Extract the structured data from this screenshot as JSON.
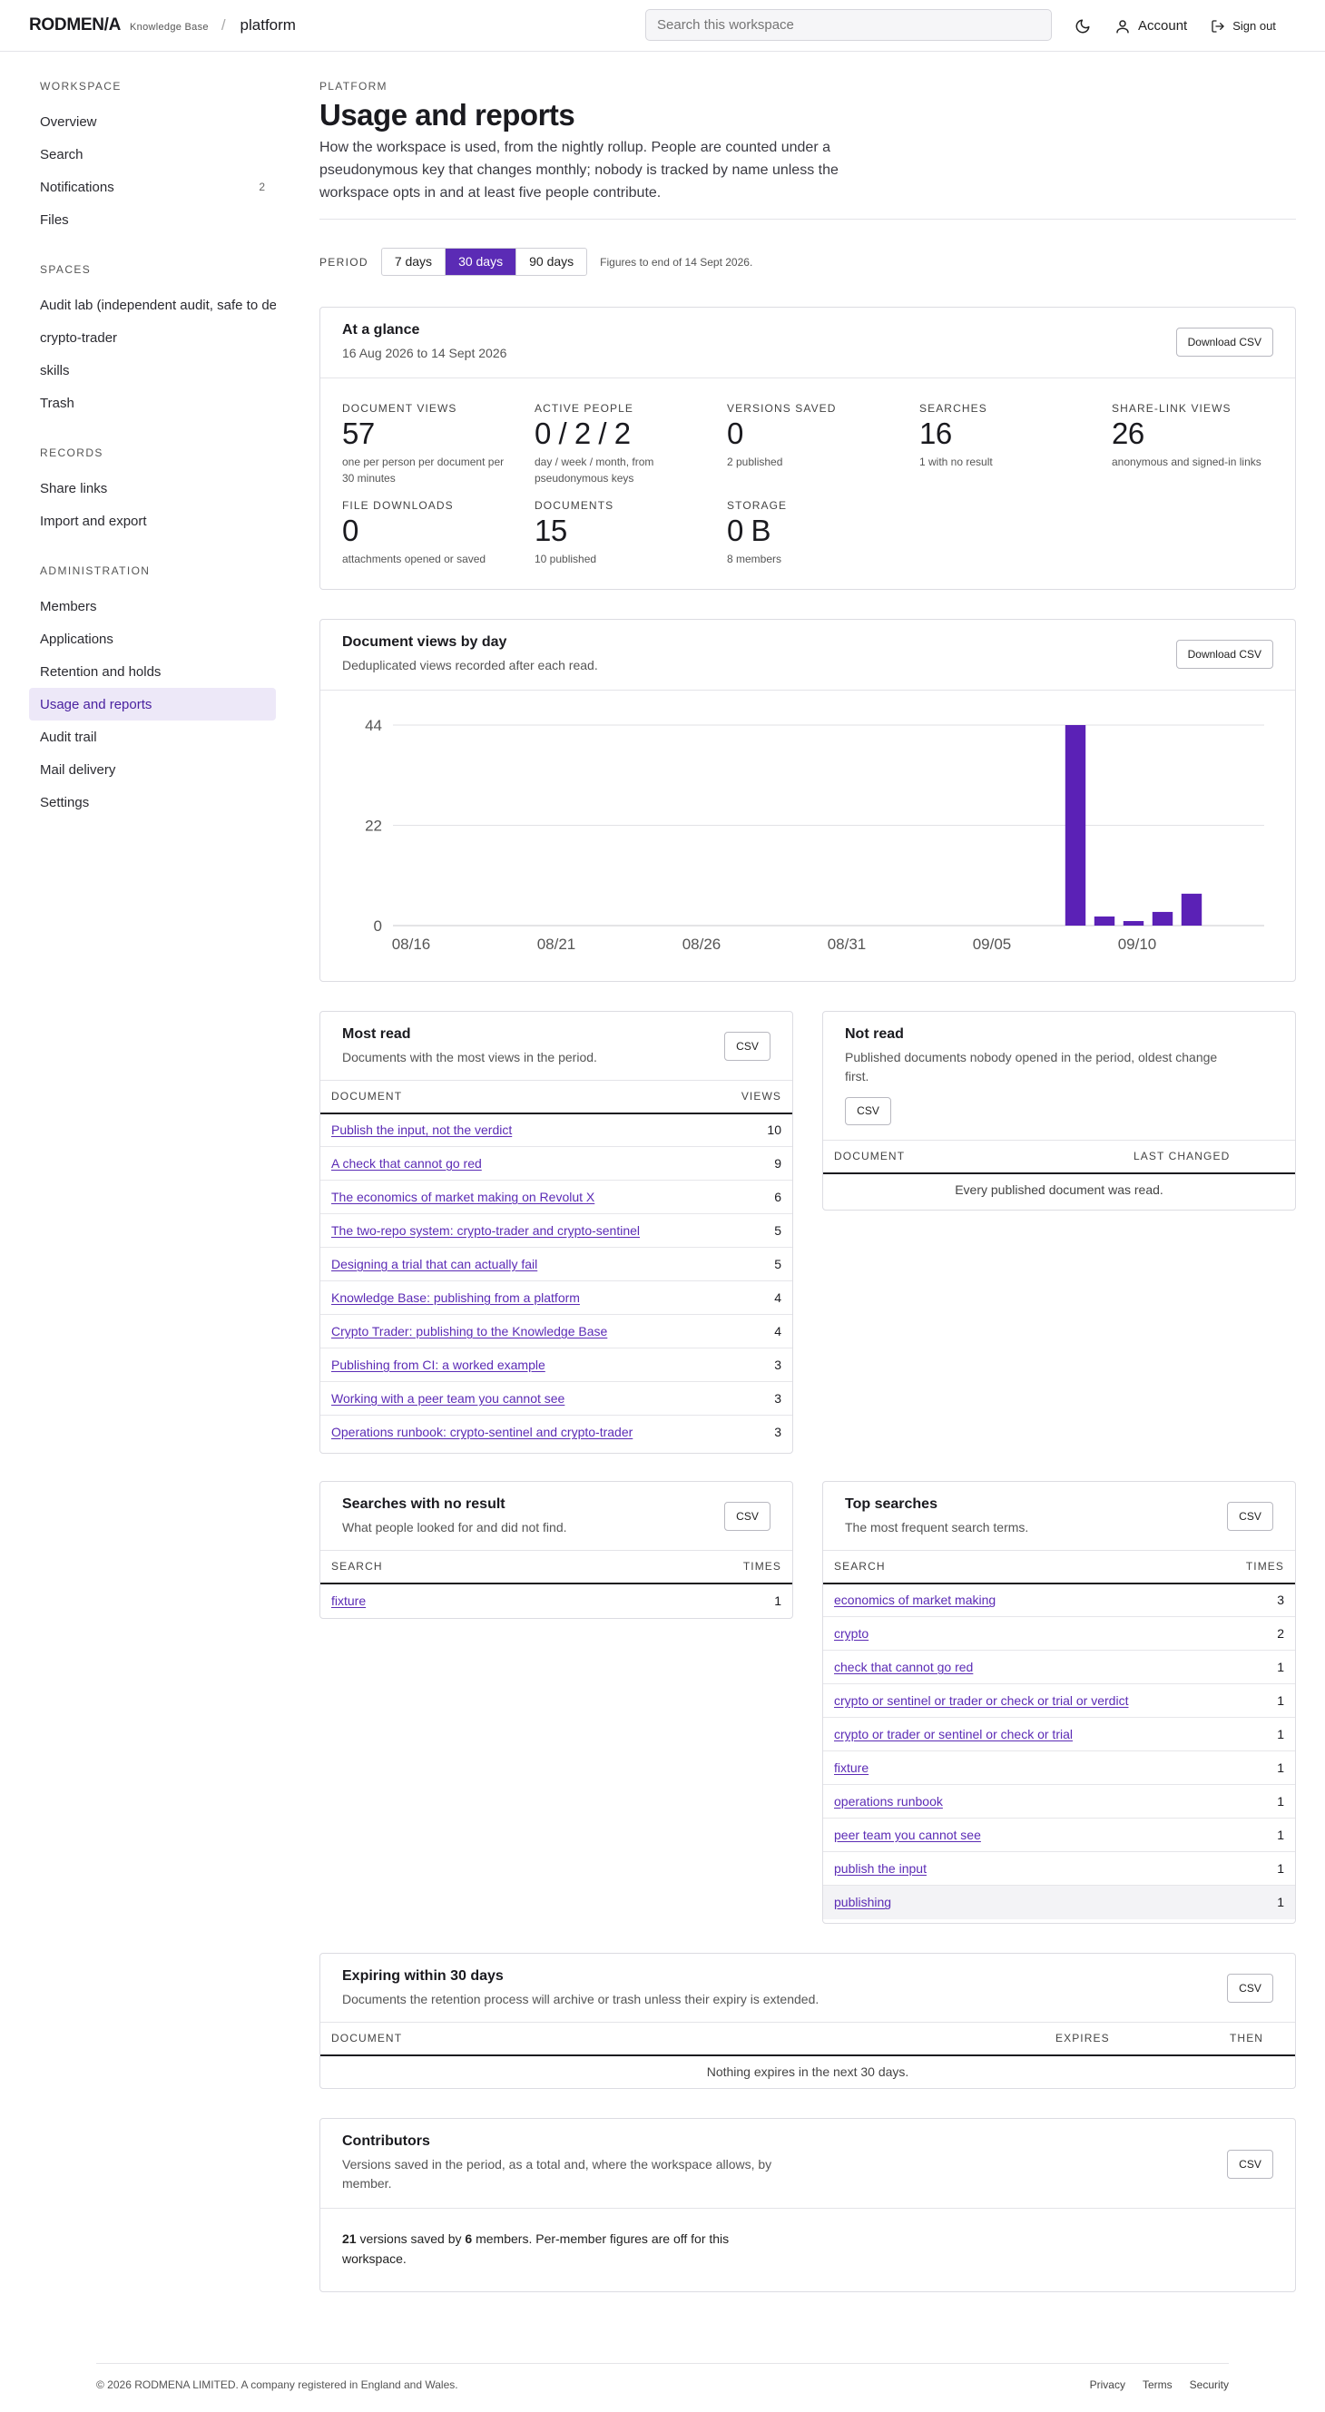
{
  "header": {
    "logo": "RODMEN/A",
    "logo_sub": "Knowledge Base",
    "breadcrumb_sep": "/",
    "breadcrumb": "platform",
    "search_placeholder": "Search this workspace",
    "account_label": "Account",
    "signout_label": "Sign out"
  },
  "sidebar": {
    "sections": [
      {
        "title": "WORKSPACE",
        "items": [
          {
            "label": "Overview"
          },
          {
            "label": "Search"
          },
          {
            "label": "Notifications",
            "badge": "2"
          },
          {
            "label": "Files"
          }
        ]
      },
      {
        "title": "SPACES",
        "items": [
          {
            "label": "Audit lab (independent audit, safe to de"
          },
          {
            "label": "crypto-trader"
          },
          {
            "label": "skills"
          },
          {
            "label": "Trash"
          }
        ]
      },
      {
        "title": "RECORDS",
        "items": [
          {
            "label": "Share links"
          },
          {
            "label": "Import and export"
          }
        ]
      },
      {
        "title": "ADMINISTRATION",
        "items": [
          {
            "label": "Members"
          },
          {
            "label": "Applications"
          },
          {
            "label": "Retention and holds"
          },
          {
            "label": "Usage and reports",
            "active": true
          },
          {
            "label": "Audit trail"
          },
          {
            "label": "Mail delivery"
          },
          {
            "label": "Settings"
          }
        ]
      }
    ]
  },
  "page": {
    "eyebrow": "PLATFORM",
    "title": "Usage and reports",
    "intro": "How the workspace is used, from the nightly rollup. People are counted under a pseudonymous key that changes monthly; nobody is tracked by name unless the workspace opts in and at least five people contribute."
  },
  "period": {
    "label": "PERIOD",
    "options": [
      "7 days",
      "30 days",
      "90 days"
    ],
    "selected": "30 days",
    "note": "Figures to end of 14 Sept 2026."
  },
  "glance": {
    "title": "At a glance",
    "subtitle": "16 Aug 2026 to 14 Sept 2026",
    "download_label": "Download CSV",
    "metrics": [
      {
        "label": "DOCUMENT VIEWS",
        "value": "57",
        "note": "one per person per document per 30 minutes"
      },
      {
        "label": "ACTIVE PEOPLE",
        "value": "0 / 2 / 2",
        "note": "day / week / month, from pseudonymous keys"
      },
      {
        "label": "VERSIONS SAVED",
        "value": "0",
        "note": "2 published"
      },
      {
        "label": "SEARCHES",
        "value": "16",
        "note": "1 with no result"
      },
      {
        "label": "SHARE-LINK VIEWS",
        "value": "26",
        "note": "anonymous and signed-in links"
      },
      {
        "label": "FILE DOWNLOADS",
        "value": "0",
        "note": "attachments opened or saved"
      },
      {
        "label": "DOCUMENTS",
        "value": "15",
        "note": "10 published"
      },
      {
        "label": "STORAGE",
        "value": "0 B",
        "note": "8 members"
      }
    ]
  },
  "views_card": {
    "title": "Document views by day",
    "subtitle": "Deduplicated views recorded after each read.",
    "download_label": "Download CSV"
  },
  "chart_data": {
    "type": "bar",
    "x_start": "2026-08-16",
    "x_ticks": [
      "08/16",
      "08/21",
      "08/26",
      "08/31",
      "09/05",
      "09/10"
    ],
    "y_ticks": [
      "0",
      "22",
      "44"
    ],
    "ylim": [
      0,
      44
    ],
    "bar_color": "#5b21b6",
    "points": [
      {
        "x": "09/08",
        "y": 44
      },
      {
        "x": "09/09",
        "y": 2
      },
      {
        "x": "09/10",
        "y": 1
      },
      {
        "x": "09/11",
        "y": 3
      },
      {
        "x": "09/12",
        "y": 7
      }
    ]
  },
  "most_read": {
    "title": "Most read",
    "subtitle": "Documents with the most views in the period.",
    "csv_label": "CSV",
    "columns": [
      "DOCUMENT",
      "VIEWS"
    ],
    "rows": [
      {
        "doc": "Publish the input, not the verdict",
        "n": "10"
      },
      {
        "doc": "A check that cannot go red",
        "n": "9"
      },
      {
        "doc": "The economics of market making on Revolut X",
        "n": "6"
      },
      {
        "doc": "The two-repo system: crypto-trader and crypto-sentinel",
        "n": "5"
      },
      {
        "doc": "Designing a trial that can actually fail",
        "n": "5"
      },
      {
        "doc": "Knowledge Base: publishing from a platform",
        "n": "4"
      },
      {
        "doc": "Crypto Trader: publishing to the Knowledge Base",
        "n": "4"
      },
      {
        "doc": "Publishing from CI: a worked example",
        "n": "3"
      },
      {
        "doc": "Working with a peer team you cannot see",
        "n": "3"
      },
      {
        "doc": "Operations runbook: crypto-sentinel and crypto-trader",
        "n": "3"
      }
    ]
  },
  "not_read": {
    "title": "Not read",
    "subtitle": "Published documents nobody opened in the period, oldest change first.",
    "csv_label": "CSV",
    "columns": [
      "DOCUMENT",
      "LAST CHANGED"
    ],
    "empty": "Every published document was read."
  },
  "no_result": {
    "title": "Searches with no result",
    "subtitle": "What people looked for and did not find.",
    "csv_label": "CSV",
    "columns": [
      "SEARCH",
      "TIMES"
    ],
    "rows": [
      {
        "q": "fixture",
        "n": "1"
      }
    ]
  },
  "top_searches": {
    "title": "Top searches",
    "subtitle": "The most frequent search terms.",
    "csv_label": "CSV",
    "columns": [
      "SEARCH",
      "TIMES"
    ],
    "rows": [
      {
        "q": "economics of market making",
        "n": "3"
      },
      {
        "q": "crypto",
        "n": "2"
      },
      {
        "q": "check that cannot go red",
        "n": "1"
      },
      {
        "q": "crypto or sentinel or trader or check or trial or verdict",
        "n": "1"
      },
      {
        "q": "crypto or trader or sentinel or check or trial",
        "n": "1"
      },
      {
        "q": "fixture",
        "n": "1"
      },
      {
        "q": "operations runbook",
        "n": "1"
      },
      {
        "q": "peer team you cannot see",
        "n": "1"
      },
      {
        "q": "publish the input",
        "n": "1"
      },
      {
        "q": "publishing",
        "n": "1"
      }
    ]
  },
  "expiring": {
    "title": "Expiring within 30 days",
    "subtitle": "Documents the retention process will archive or trash unless their expiry is extended.",
    "csv_label": "CSV",
    "columns": [
      "DOCUMENT",
      "EXPIRES",
      "THEN"
    ],
    "empty": "Nothing expires in the next 30 days."
  },
  "contributors": {
    "title": "Contributors",
    "subtitle": "Versions saved in the period, as a total and, where the workspace allows, by member.",
    "csv_label": "CSV",
    "versions": "21",
    "text_a": " versions saved by ",
    "members": "6",
    "text_b": " members. Per-member figures are off for this workspace."
  },
  "footer": {
    "copyright": "© 2026 RODMENA LIMITED. A company registered in England and Wales.",
    "links": [
      "Privacy",
      "Terms",
      "Security"
    ]
  }
}
